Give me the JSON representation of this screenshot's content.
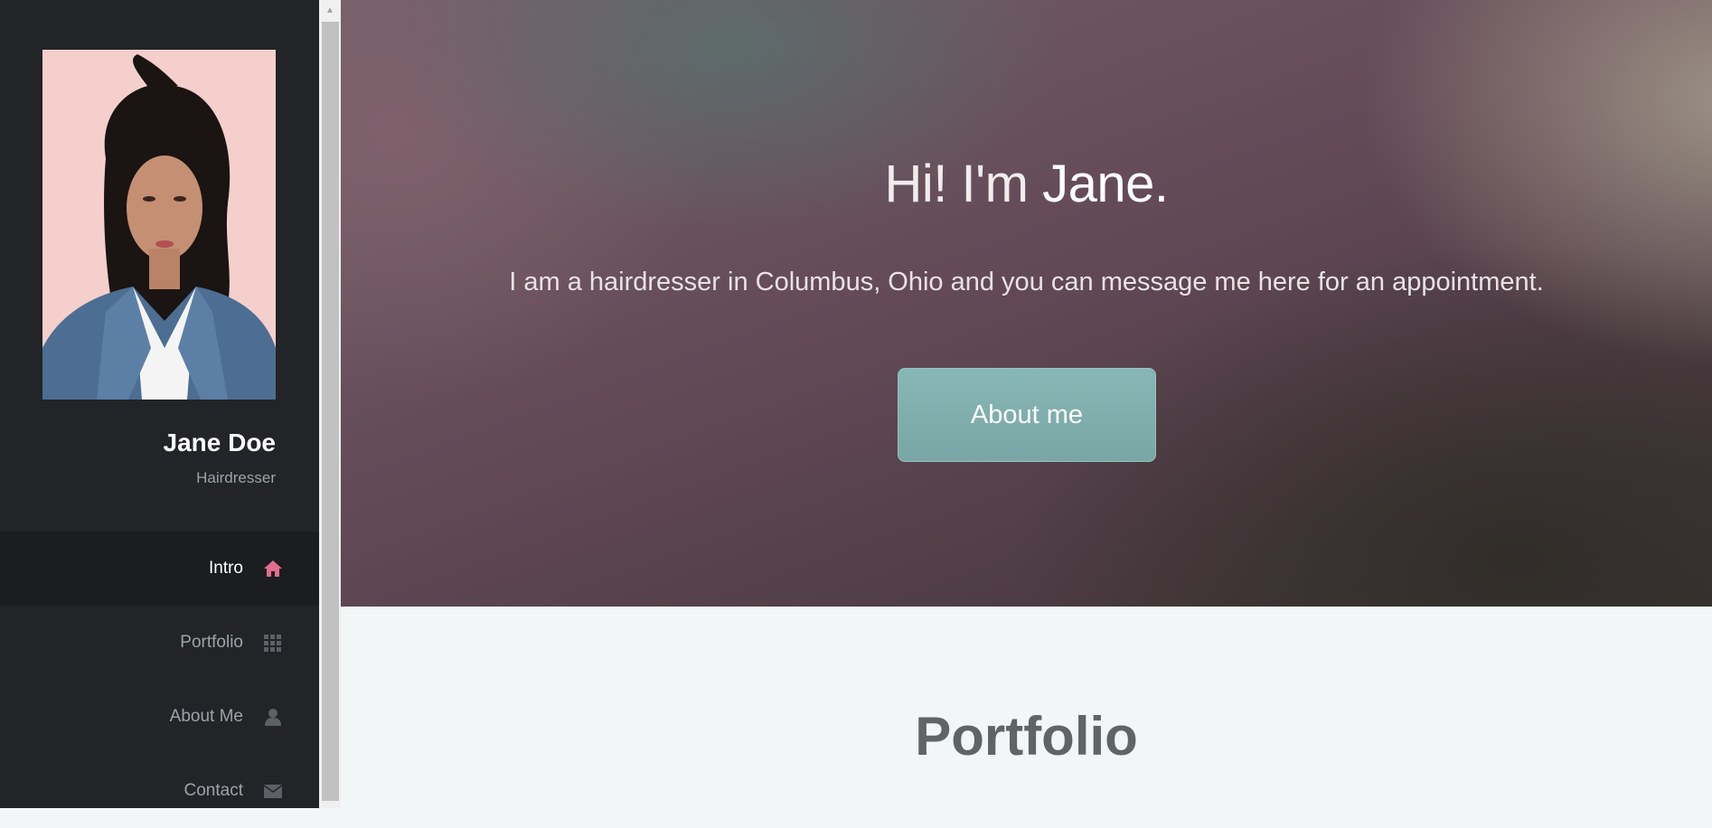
{
  "profile": {
    "name": "Jane Doe",
    "role": "Hairdresser"
  },
  "nav": {
    "items": [
      {
        "label": "Intro",
        "icon": "home-icon",
        "active": true
      },
      {
        "label": "Portfolio",
        "icon": "grid-icon",
        "active": false
      },
      {
        "label": "About Me",
        "icon": "user-icon",
        "active": false
      },
      {
        "label": "Contact",
        "icon": "envelope-icon",
        "active": false
      }
    ]
  },
  "hero": {
    "title_prefix": "Hi! I'm ",
    "title_name": "Jane.",
    "subtitle": "I am a hairdresser in Columbus, Ohio and you can message me here for an appointment.",
    "button_label": "About me"
  },
  "portfolio": {
    "title": "Portfolio"
  },
  "colors": {
    "sidebar_bg": "#222427",
    "active_icon": "#e26d8d",
    "inactive_icon": "#5d6166",
    "button_bg": "#80afae"
  }
}
